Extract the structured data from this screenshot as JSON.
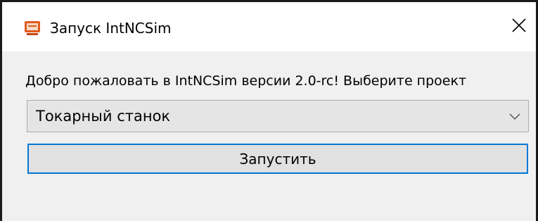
{
  "window": {
    "title": "Запуск IntNCSim",
    "app_icon": "monitor-icon",
    "close_icon": "close-icon",
    "accent_color": "#0078d7",
    "icon_color": "#e05a1c"
  },
  "main": {
    "welcome_text": "Добро пожаловать в IntNCSim версии 2.0-rc! Выберите проект",
    "project_select": {
      "selected": "Токарный станок",
      "icon": "chevron-down-icon"
    },
    "run_button_label": "Запустить"
  }
}
